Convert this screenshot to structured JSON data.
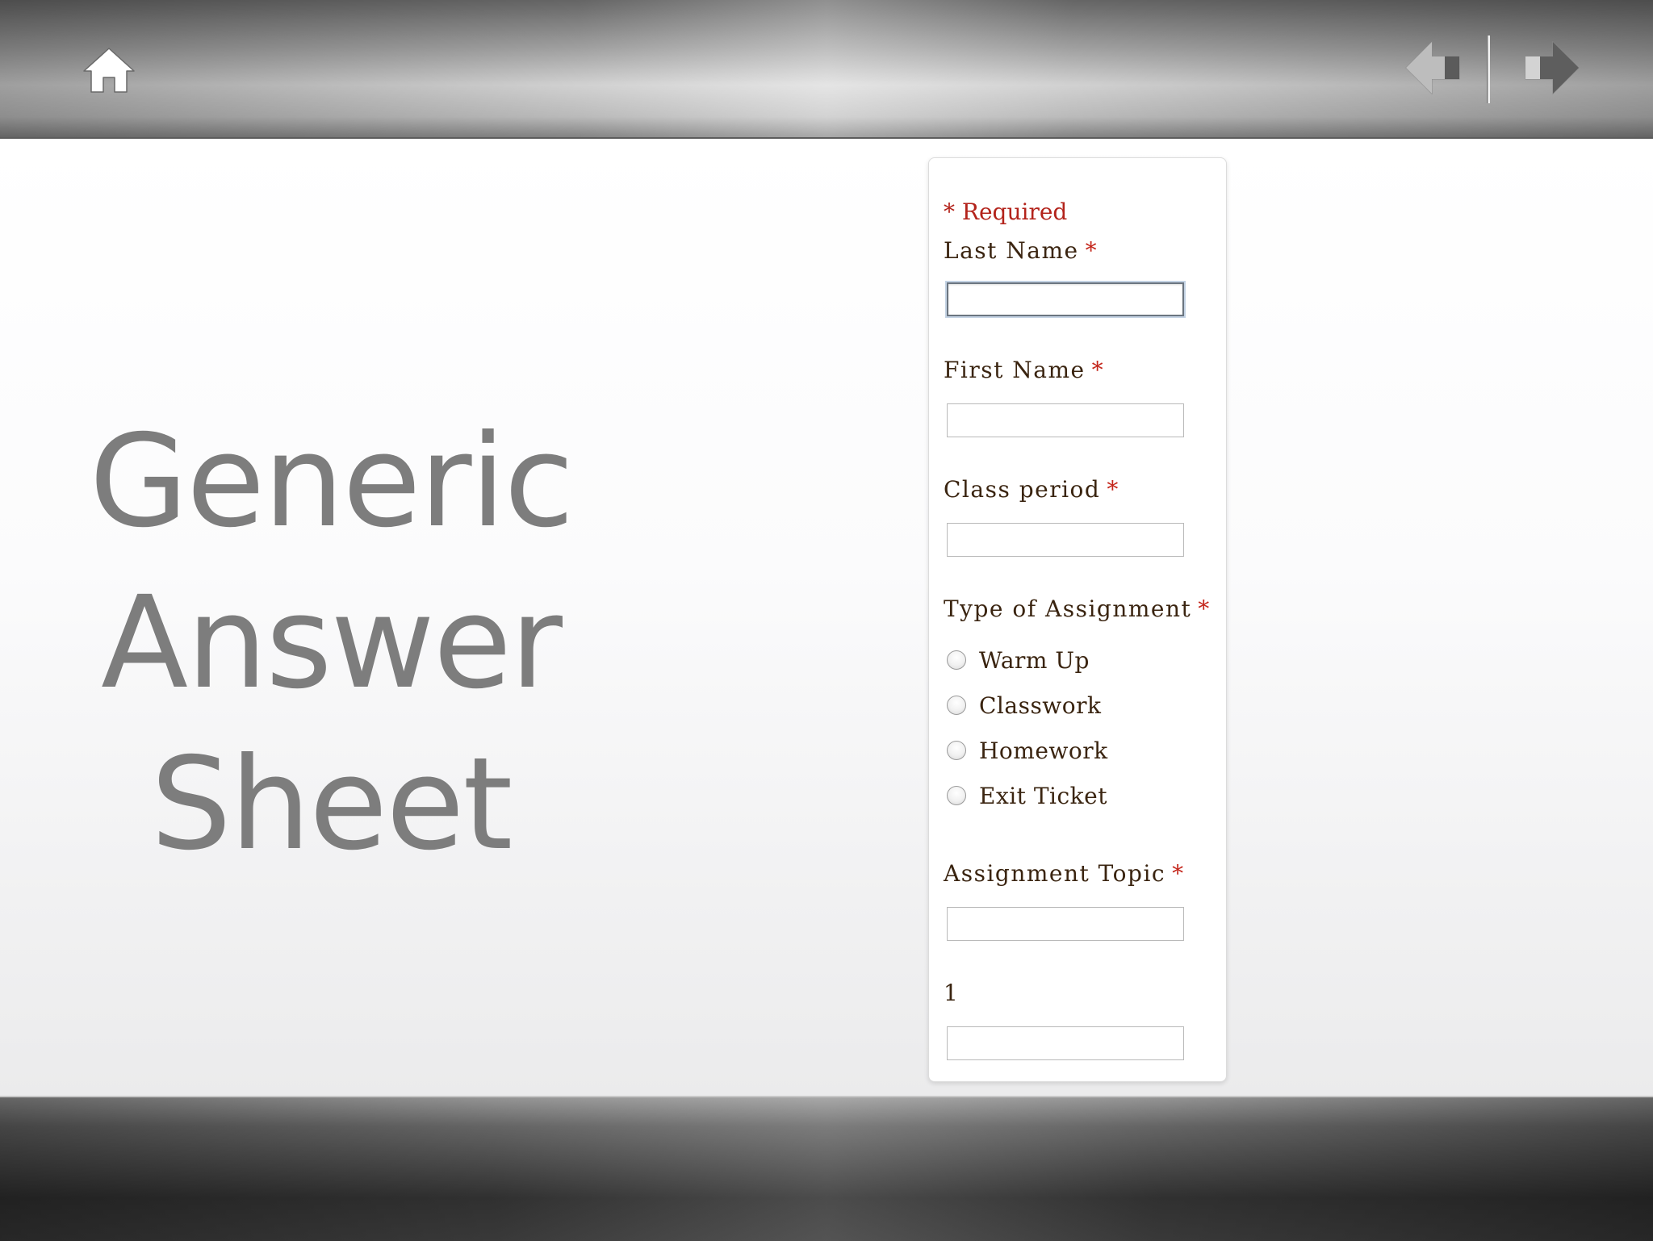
{
  "toolbar": {
    "home_icon": "home-icon",
    "back_icon": "arrow-left-icon",
    "forward_icon": "arrow-right-icon"
  },
  "slide": {
    "title_lines": [
      "Generic",
      "Answer",
      "Sheet"
    ],
    "title_color": "#7d7d7d"
  },
  "form": {
    "required_note": "* Required",
    "required_marker": "*",
    "accent_color": "#b3231b",
    "fields": {
      "last_name": {
        "label": "Last Name",
        "value": ""
      },
      "first_name": {
        "label": "First Name",
        "value": ""
      },
      "class_period": {
        "label": "Class period",
        "value": ""
      },
      "assignment_type": {
        "label": "Type of Assignment",
        "options": [
          "Warm Up",
          "Classwork",
          "Homework",
          "Exit Ticket"
        ]
      },
      "assignment_topic": {
        "label": "Assignment Topic",
        "value": ""
      },
      "q1": {
        "label": "1",
        "value": ""
      }
    }
  }
}
